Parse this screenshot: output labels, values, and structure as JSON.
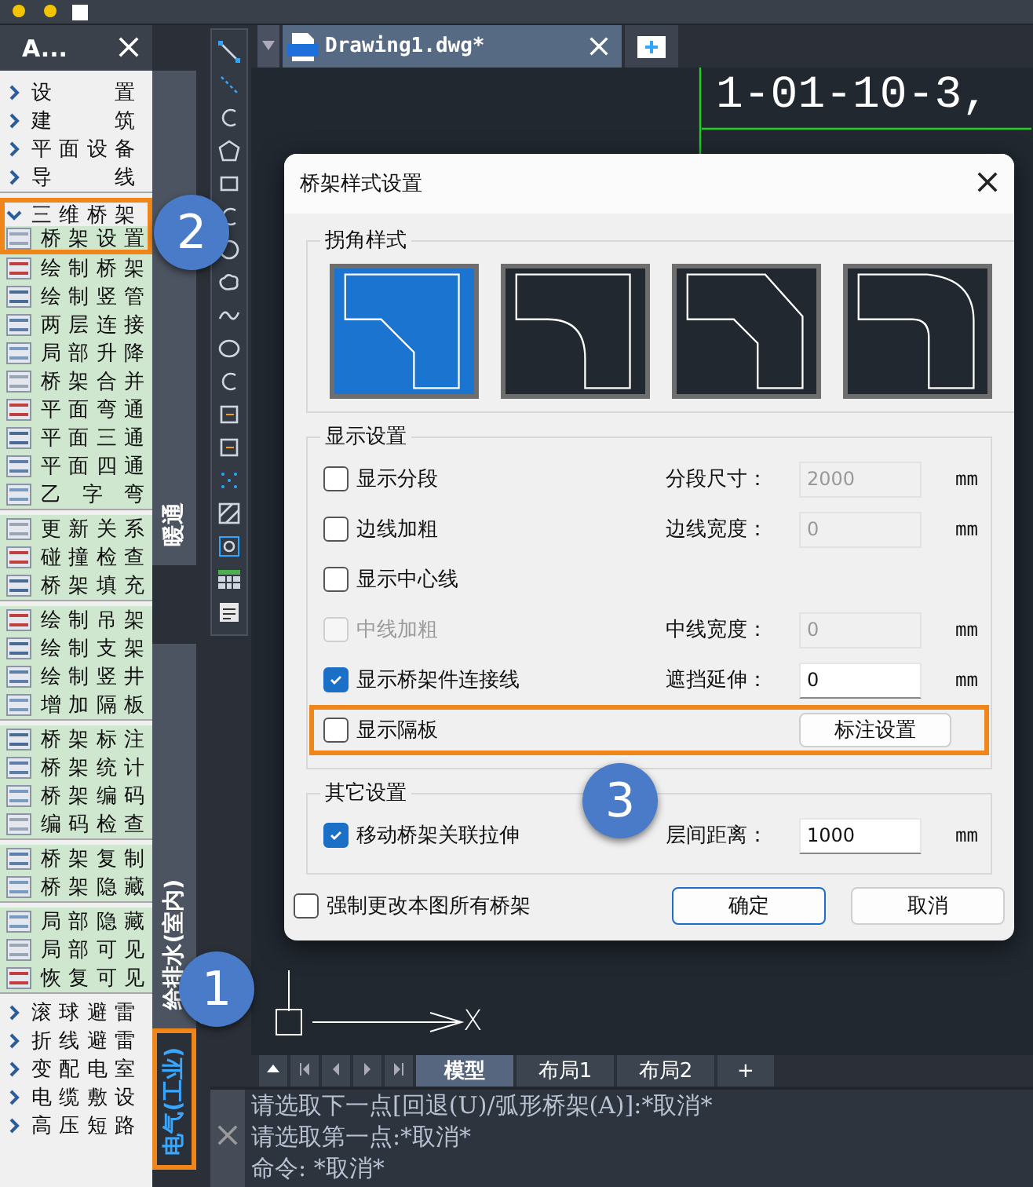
{
  "side_panel": {
    "title": "A...",
    "groups": [
      {
        "items": [
          {
            "kind": "category",
            "label": "设置",
            "expanded": false,
            "outlined": false
          },
          {
            "kind": "category",
            "label": "建筑",
            "expanded": false,
            "outlined": false
          },
          {
            "kind": "category",
            "label": "平面设备",
            "expanded": false,
            "outlined": false
          },
          {
            "kind": "category",
            "label": "导线",
            "expanded": false,
            "outlined": false
          }
        ]
      },
      {
        "items": [
          {
            "kind": "category",
            "label": "三维桥架",
            "expanded": true,
            "outlined": true
          },
          {
            "kind": "tool",
            "label": "桥架设置",
            "outlined": true
          },
          {
            "kind": "tool",
            "label": "绘制桥架",
            "outlined": false
          },
          {
            "kind": "tool",
            "label": "绘制竖管",
            "outlined": false
          },
          {
            "kind": "tool",
            "label": "两层连接",
            "outlined": false
          },
          {
            "kind": "tool",
            "label": "局部升降",
            "outlined": false
          },
          {
            "kind": "tool",
            "label": "桥架合并",
            "outlined": false
          },
          {
            "kind": "tool",
            "label": "平面弯通",
            "outlined": false
          },
          {
            "kind": "tool",
            "label": "平面三通",
            "outlined": false
          },
          {
            "kind": "tool",
            "label": "平面四通",
            "outlined": false
          },
          {
            "kind": "tool",
            "label": "乙字弯",
            "outlined": false
          }
        ]
      },
      {
        "items": [
          {
            "kind": "tool",
            "label": "更新关系",
            "outlined": false
          },
          {
            "kind": "tool",
            "label": "碰撞检查",
            "outlined": false
          },
          {
            "kind": "tool",
            "label": "桥架填充",
            "outlined": false
          }
        ]
      },
      {
        "items": [
          {
            "kind": "tool",
            "label": "绘制吊架",
            "outlined": false
          },
          {
            "kind": "tool",
            "label": "绘制支架",
            "outlined": false
          },
          {
            "kind": "tool",
            "label": "绘制竖井",
            "outlined": false
          },
          {
            "kind": "tool",
            "label": "增加隔板",
            "outlined": false
          }
        ]
      },
      {
        "items": [
          {
            "kind": "tool",
            "label": "桥架标注",
            "outlined": false
          },
          {
            "kind": "tool",
            "label": "桥架统计",
            "outlined": false
          },
          {
            "kind": "tool",
            "label": "桥架编码",
            "outlined": false
          },
          {
            "kind": "tool",
            "label": "编码检查",
            "outlined": false
          }
        ]
      },
      {
        "items": [
          {
            "kind": "tool",
            "label": "桥架复制",
            "outlined": false
          },
          {
            "kind": "tool",
            "label": "桥架隐藏",
            "outlined": false
          }
        ]
      },
      {
        "items": [
          {
            "kind": "tool",
            "label": "局部隐藏",
            "outlined": false
          },
          {
            "kind": "tool",
            "label": "局部可见",
            "outlined": false
          },
          {
            "kind": "tool",
            "label": "恢复可见",
            "outlined": false
          }
        ]
      },
      {
        "items": [
          {
            "kind": "category",
            "label": "滚球避雷",
            "expanded": false,
            "outlined": false
          },
          {
            "kind": "category",
            "label": "折线避雷",
            "expanded": false,
            "outlined": false
          },
          {
            "kind": "category",
            "label": "变配电室",
            "expanded": false,
            "outlined": false
          },
          {
            "kind": "category",
            "label": "电缆敷设",
            "expanded": false,
            "outlined": false
          },
          {
            "kind": "category",
            "label": "高压短路",
            "expanded": false,
            "outlined": false
          }
        ]
      }
    ]
  },
  "side_tabs": [
    {
      "label": "暖通",
      "selected": false,
      "outlined": false
    },
    {
      "label": "给排水(室内)",
      "selected": false,
      "outlined": false
    },
    {
      "label": "电气(工业)",
      "selected": true,
      "outlined": true
    }
  ],
  "document_tabs": [
    {
      "title": "Drawing1.dwg*",
      "selected": true
    }
  ],
  "canvas": {
    "text": "1-01-10-3,",
    "axis_label": "X"
  },
  "dialog": {
    "title": "桥架样式设置",
    "corner_group": {
      "title": "拐角样式",
      "options": [
        {
          "kind": "chamfer",
          "selected": true
        },
        {
          "kind": "round",
          "selected": false
        },
        {
          "kind": "bevel",
          "selected": false
        },
        {
          "kind": "curve",
          "selected": false
        }
      ]
    },
    "display_group": {
      "title": "显示设置",
      "rows": [
        {
          "label": "显示分段",
          "checked": false,
          "disabled": false,
          "field_label": "分段尺寸：",
          "value": "2000",
          "field_disabled": true,
          "unit": "mm",
          "outlined": false
        },
        {
          "label": "边线加粗",
          "checked": false,
          "disabled": false,
          "field_label": "边线宽度：",
          "value": "0",
          "field_disabled": true,
          "unit": "mm",
          "outlined": false
        },
        {
          "label": "显示中心线",
          "checked": false,
          "disabled": false,
          "outlined": false
        },
        {
          "label": "中线加粗",
          "checked": false,
          "disabled": true,
          "field_label": "中线宽度：",
          "value": "0",
          "field_disabled": true,
          "unit": "mm",
          "outlined": false
        },
        {
          "label": "显示桥架件连接线",
          "checked": true,
          "disabled": false,
          "field_label": "遮挡延伸：",
          "value": "0",
          "field_disabled": false,
          "unit": "mm",
          "outlined": false
        },
        {
          "label": "显示隔板",
          "checked": false,
          "disabled": false,
          "button": "标注设置",
          "outlined": true
        }
      ]
    },
    "other_group": {
      "title": "其它设置",
      "rows": [
        {
          "label": "移动桥架关联拉伸",
          "checked": true,
          "disabled": false,
          "field_label": "层间距离：",
          "value": "1000",
          "field_disabled": false,
          "unit": "mm",
          "outlined": false
        }
      ]
    },
    "force_all": {
      "label": "强制更改本图所有桥架",
      "checked": false
    },
    "buttons": [
      {
        "label": "确定",
        "default": true
      },
      {
        "label": "取消",
        "default": false
      }
    ]
  },
  "layout_tabs": [
    {
      "label": "模型",
      "selected": true
    },
    {
      "label": "布局1",
      "selected": false
    },
    {
      "label": "布局2",
      "selected": false
    }
  ],
  "new_layout_button": "+",
  "command_lines": [
    "请选取下一点[回退(U)/弧形桥架(A)]:*取消*",
    "请选取第一点:*取消*",
    "命令: *取消*"
  ],
  "callouts": [
    {
      "label": "1"
    },
    {
      "label": "2"
    },
    {
      "label": "3"
    }
  ]
}
